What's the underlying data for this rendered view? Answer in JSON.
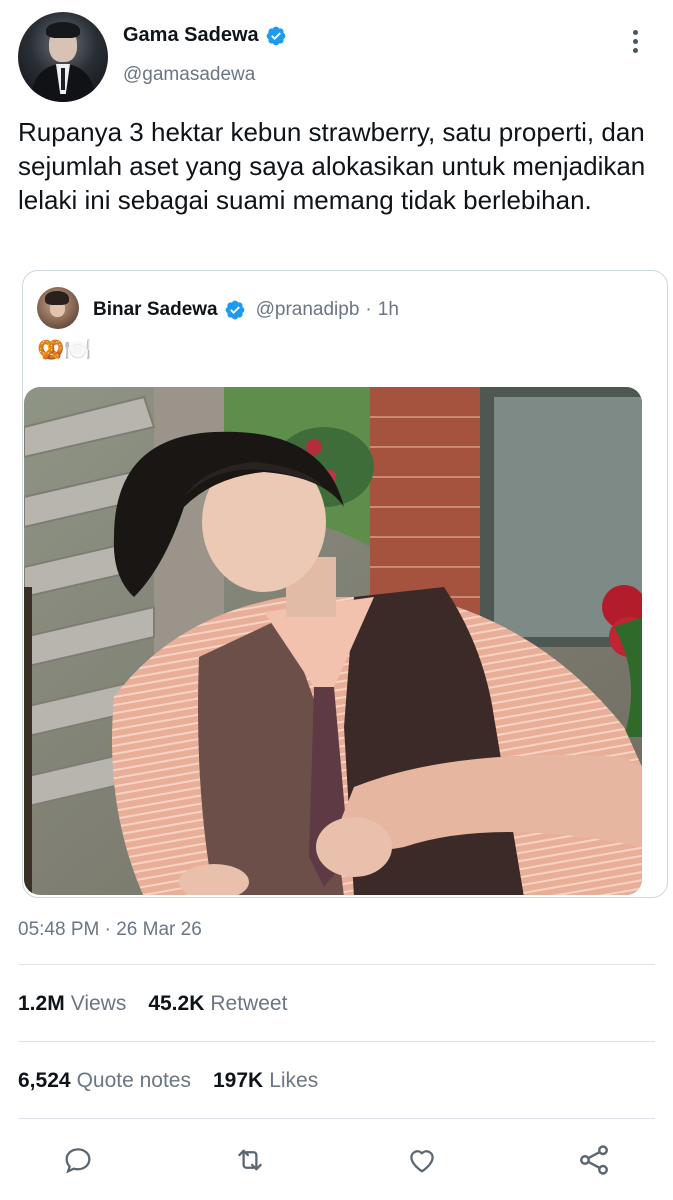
{
  "author": {
    "display_name": "Gama Sadewa",
    "handle": "@gamasadewa",
    "verified": true
  },
  "tweet": {
    "text": "Rupanya 3 hektar kebun strawberry, satu properti, dan sejumlah aset yang saya alokasikan untuk menjadikan lelaki ini sebagai suami memang tidak berlebihan."
  },
  "quoted": {
    "display_name": "Binar Sadewa",
    "handle": "@pranadipb",
    "separator": "·",
    "age": "1h",
    "text": "🥨🍽️"
  },
  "meta": {
    "timestamp": "05:48 PM · 26 Mar 26"
  },
  "stats": {
    "views_count": "1.2M",
    "views_label": "Views",
    "retweet_count": "45.2K",
    "retweet_label": "Retweet",
    "quotes_count": "6,524",
    "quotes_label": "Quote notes",
    "likes_count": "197K",
    "likes_label": "Likes"
  },
  "actions": [
    "reply-icon",
    "retweet-icon",
    "like-icon",
    "share-icon"
  ],
  "colors": {
    "verified": "#1d9bf0",
    "secondary_text": "#6b7682",
    "divider": "#dde3e8",
    "icon": "#5b6670"
  }
}
